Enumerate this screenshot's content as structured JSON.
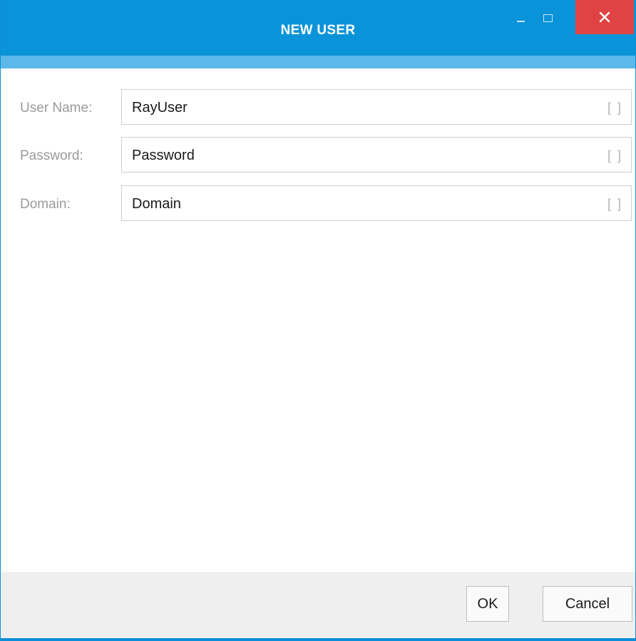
{
  "window": {
    "title": "NEW USER",
    "controls": {
      "minimize_icon": "minimize-icon",
      "maximize_icon": "maximize-icon",
      "close_label": "✕"
    },
    "colors": {
      "titlebar": "#0a93d8",
      "accent_strip": "#5bb8e8",
      "close": "#e04343"
    }
  },
  "form": {
    "fields": [
      {
        "label": "User Name:",
        "value": "RayUser",
        "trail": "[ ]"
      },
      {
        "label": "Password:",
        "value": "Password",
        "trail": "[ ]"
      },
      {
        "label": "Domain:",
        "value": "Domain",
        "trail": "[ ]"
      }
    ]
  },
  "footer": {
    "ok_label": "OK",
    "cancel_label": "Cancel"
  }
}
